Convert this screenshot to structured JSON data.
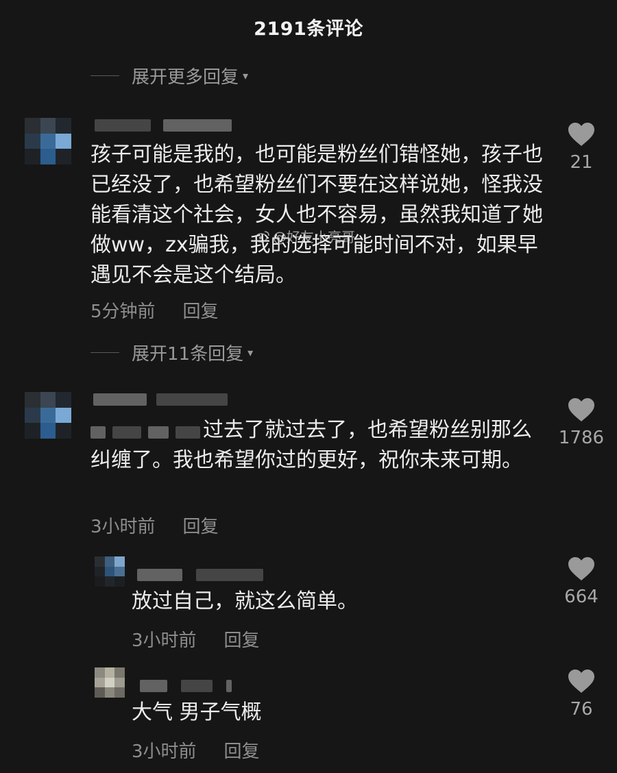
{
  "header": {
    "title": "2191条评论"
  },
  "expand_more": {
    "label": "展开更多回复",
    "arrow": "▾"
  },
  "comments": [
    {
      "text": "孩子可能是我的，也可能是粉丝们错怪她，孩子也已经没了，也希望粉丝们不要在这样说她，怪我没能看清这个社会，女人也不容易，虽然我知道了她做ww，zx骗我，我的选择可能时间不对，如果早遇见不会是这个结局。",
      "time": "5分钟前",
      "reply": "回复",
      "likes": "21"
    },
    {
      "text": "过去了就过去了，也希望粉丝别那么纠缠了。我也希望你过的更好，祝你未来可期。",
      "time": "3小时前",
      "reply": "回复",
      "likes": "1786"
    }
  ],
  "expand_replies": {
    "label": "展开11条回复",
    "arrow": "▾"
  },
  "replies": [
    {
      "text": "放过自己，就这么简单。",
      "time": "3小时前",
      "reply": "回复",
      "likes": "664"
    },
    {
      "text": "大气 男子气概",
      "time": "3小时前",
      "reply": "回复",
      "likes": "76"
    }
  ],
  "watermark": {
    "text": "@好友小亮哥",
    "icon": "weibo-icon"
  },
  "colors": {
    "background": "#161616",
    "text": "#ececec",
    "muted": "#8e8e8e",
    "heart": "#9a9a9a"
  }
}
